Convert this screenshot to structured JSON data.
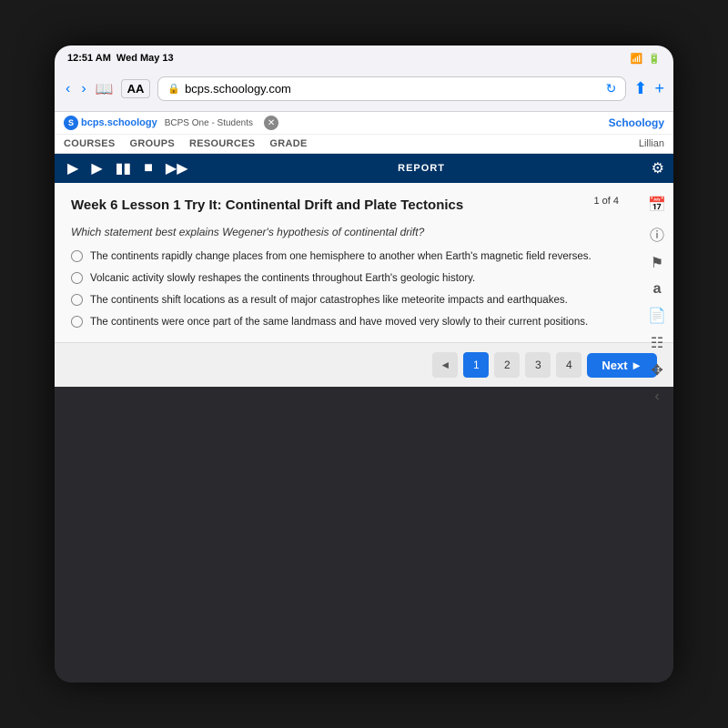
{
  "statusBar": {
    "time": "12:51 AM",
    "date": "Wed May 13",
    "wifi": "wifi",
    "battery": "7"
  },
  "browser": {
    "url": "bcps.schoology.com",
    "aa_label": "AA",
    "back": "‹",
    "forward": "›"
  },
  "nav": {
    "logo": "S",
    "site_name": "bcps.schoology",
    "tab_text": "BCPS One - Students",
    "schoology_label": "Schoology",
    "menu_items": [
      "COURSES",
      "GROUPS",
      "RESOURCES",
      "GRADE"
    ],
    "user": "Lillian"
  },
  "media_bar": {
    "report_label": "REPORT"
  },
  "content": {
    "title": "Week 6 Lesson 1 Try It: Continental Drift and Plate Tectonics",
    "page_counter": "1 of 4",
    "question": "Which statement best explains Wegener's hypothesis of continental drift?",
    "options": [
      "The continents rapidly change places from one hemisphere to another when Earth's magnetic field reverses.",
      "Volcanic activity slowly reshapes the continents throughout Earth's geologic history.",
      "The continents shift locations as a result of major catastrophes like meteorite impacts and earthquakes.",
      "The continents were once part of the same landmass and have moved very slowly to their current positions."
    ]
  },
  "pagination": {
    "prev_arrow": "◄",
    "pages": [
      "1",
      "2",
      "3",
      "4"
    ],
    "active_page": "1",
    "next_label": "Next ►"
  }
}
